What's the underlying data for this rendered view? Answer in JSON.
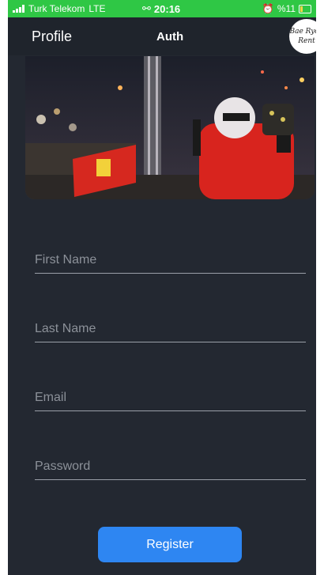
{
  "status_bar": {
    "carrier": "Turk Telekom",
    "network": "LTE",
    "time": "20:16",
    "battery_percent": "%11"
  },
  "header": {
    "profile_tab": "Profile",
    "auth_tab": "Auth",
    "logo_line1": "Bae Ryde",
    "logo_line2": "Rent"
  },
  "form": {
    "first_name_placeholder": "First Name",
    "last_name_placeholder": "Last Name",
    "email_placeholder": "Email",
    "password_placeholder": "Password",
    "register_label": "Register"
  },
  "colors": {
    "status_bar": "#2fc745",
    "background": "#232831",
    "accent": "#2e86f2"
  }
}
